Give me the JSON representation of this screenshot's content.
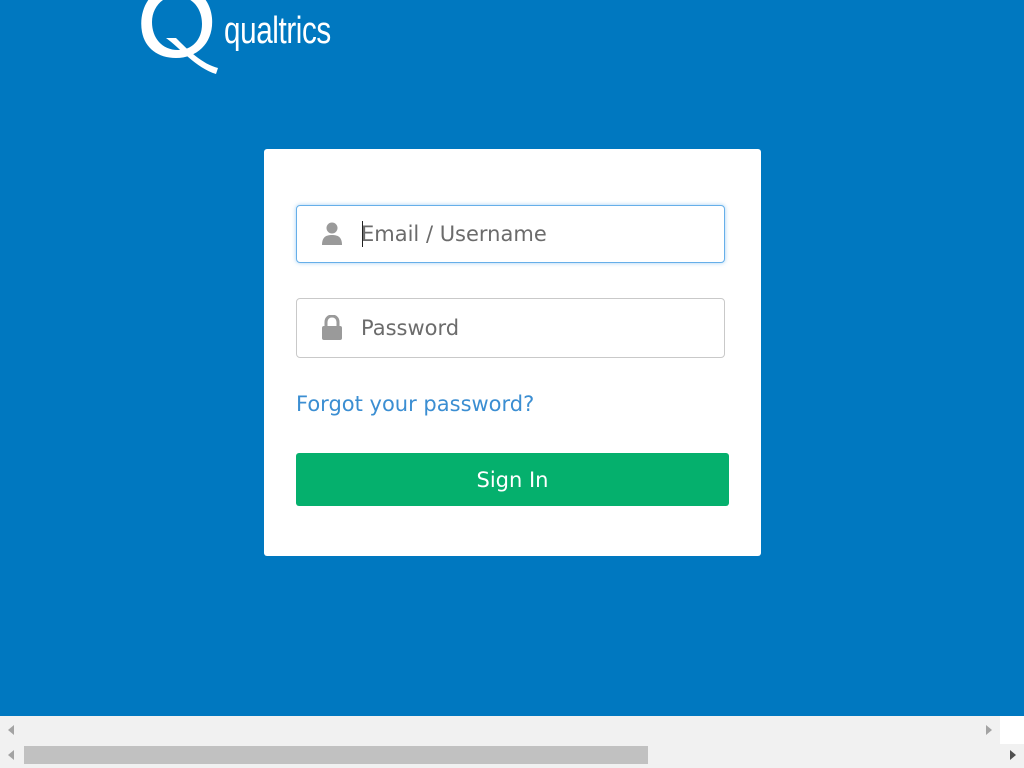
{
  "brand": {
    "name": "qualtrics",
    "color": "#0078c0"
  },
  "login": {
    "email_placeholder": "Email / Username",
    "email_icon": "user-icon",
    "password_placeholder": "Password",
    "password_icon": "lock-icon",
    "forgot_label": "Forgot your password?",
    "signin_label": "Sign In",
    "signin_color": "#05b06d",
    "link_color": "#3b8ed2"
  }
}
